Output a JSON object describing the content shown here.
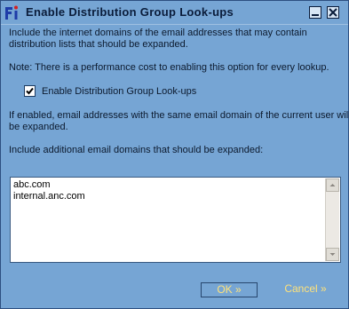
{
  "window": {
    "title": "Enable Distribution Group Look-ups"
  },
  "content": {
    "intro_line1": "Include the internet domains of the email addresses that may contain",
    "intro_line2": "distribution lists that should be expanded.",
    "note": "Note: There is a performance cost to enabling this option for every lookup.",
    "checkbox_label": "Enable Distribution Group Look-ups",
    "checkbox_checked": true,
    "if_enabled_line1": "If enabled, email addresses with the same email domain of the current user will",
    "if_enabled_line2": "be expanded.",
    "additional_label": "Include additional email domains that should be expanded:"
  },
  "domains": {
    "lines": [
      "abc.com",
      "internal.anc.com"
    ]
  },
  "buttons": {
    "ok_label": "OK »",
    "cancel_label": "Cancel »"
  },
  "colors": {
    "background": "#76a5d4",
    "button_text": "#ffe27a",
    "title_icon_accent": "#d42020"
  }
}
